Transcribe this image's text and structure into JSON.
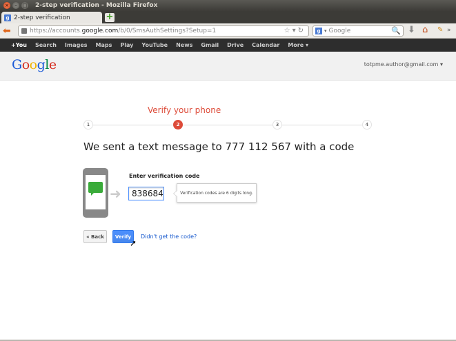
{
  "window": {
    "title": "2-step verification - Mozilla Firefox"
  },
  "tab": {
    "label": "2-step verification",
    "favicon": "g"
  },
  "url": {
    "prefix": "https://accounts.",
    "domain": "google.com",
    "suffix": "/b/0/SmsAuthSettings?Setup=1"
  },
  "search": {
    "placeholder": "Google",
    "engine": "g"
  },
  "gbar": {
    "items": [
      "+You",
      "Search",
      "Images",
      "Maps",
      "Play",
      "YouTube",
      "News",
      "Gmail",
      "Drive",
      "Calendar",
      "More ▾"
    ]
  },
  "header": {
    "logo": "Google",
    "account": "totpme.author@gmail.com ▾"
  },
  "steps": {
    "title": "Verify your phone",
    "labels": [
      "1",
      "2",
      "3",
      "4"
    ],
    "active": 2
  },
  "main": {
    "headline": "We sent a text message to 777 112 567 with a code",
    "code_label": "Enter verification code",
    "code_value": "838684",
    "tooltip": "Verification codes are 6 digits long.",
    "back_label": "« Back",
    "verify_label": "Verify",
    "didnt_get": "Didn't get the code?"
  },
  "colors": {
    "accent": "#dd4b39",
    "button_blue": "#4d90fe",
    "link": "#1155cc"
  }
}
